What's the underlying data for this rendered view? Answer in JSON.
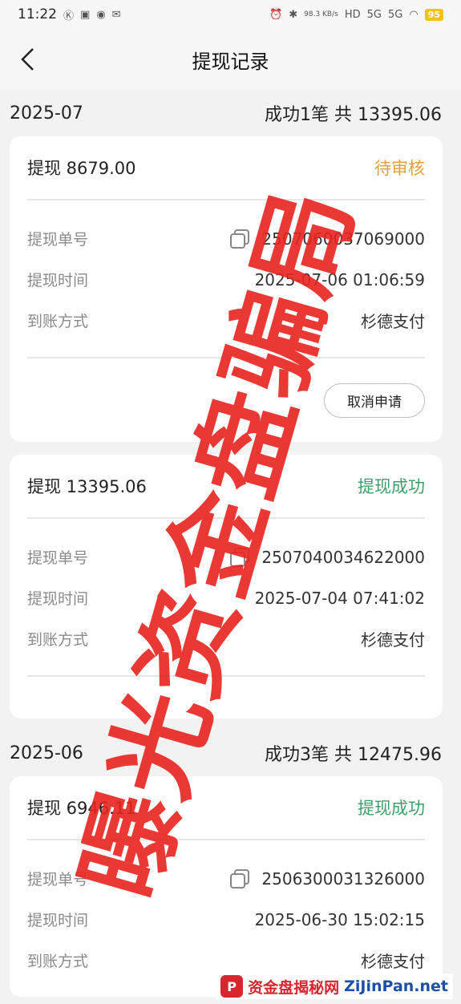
{
  "status_bar": {
    "time": "11:22",
    "speed": "98.3 KB/s",
    "network1": "5G",
    "network2": "5G",
    "battery": "95"
  },
  "nav": {
    "title": "提现记录"
  },
  "labels": {
    "order_no": "提现单号",
    "time": "提现时间",
    "method": "到账方式",
    "cancel": "取消申请"
  },
  "months": [
    {
      "month": "2025-07",
      "summary": "成功1笔 共 13395.06",
      "records": [
        {
          "title": "提现 8679.00",
          "status": "待审核",
          "order_no": "2507060037069000",
          "time": "2025-07-06 01:06:59",
          "method": "杉德支付"
        },
        {
          "title": "提现 13395.06",
          "status": "提现成功",
          "order_no": "2507040034622000",
          "time": "2025-07-04 07:41:02",
          "method": "杉德支付"
        }
      ]
    },
    {
      "month": "2025-06",
      "summary": "成功3笔 共 12475.96",
      "records": [
        {
          "title": "提现 6946.11",
          "status": "提现成功",
          "order_no": "2506300031326000",
          "time": "2025-06-30 15:02:15",
          "method": "杉德支付"
        }
      ]
    }
  ],
  "watermark": {
    "text": "曝光资金盘骗局"
  },
  "footer": {
    "brand_logo": "P",
    "brand_cn": "资金盘揭秘网",
    "brand_en": "ZiJinPan.net"
  },
  "colors": {
    "pending": "#e2a23b",
    "success": "#3f9f6a",
    "watermark": "#e8231e"
  }
}
